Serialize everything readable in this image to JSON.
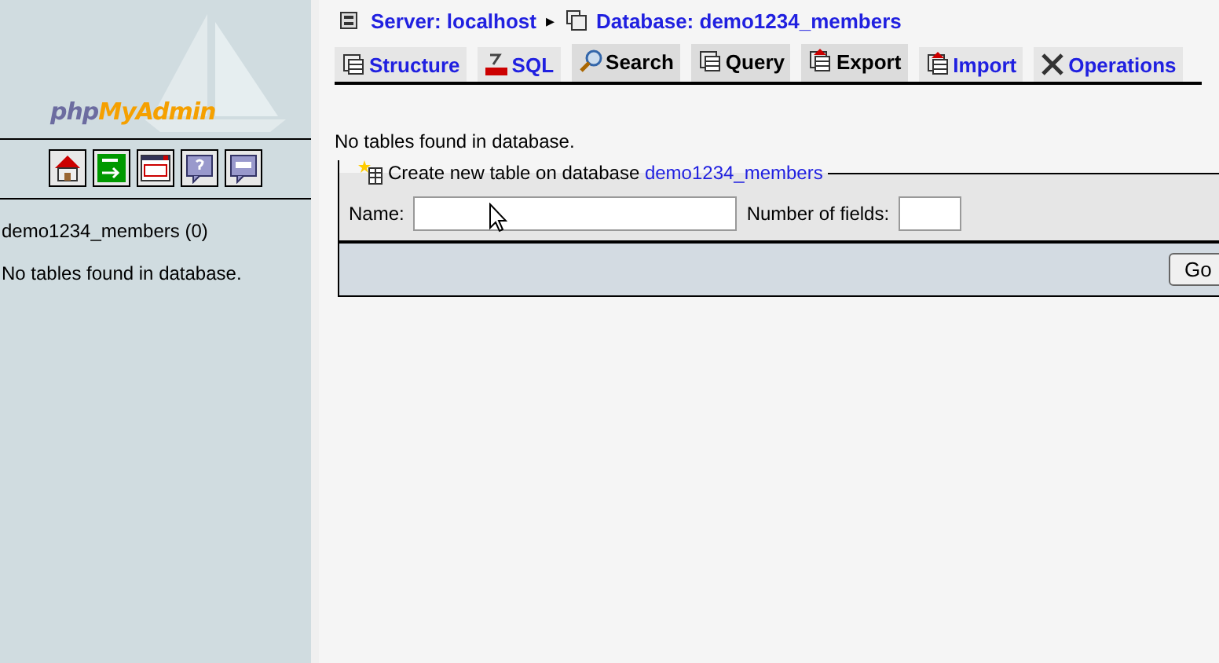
{
  "sidebar": {
    "logo": {
      "prefix": "php",
      "suffix": "MyAdmin"
    },
    "database": "demo1234_members (0)",
    "message": "No tables found in database."
  },
  "breadcrumb": {
    "server": "Server: localhost",
    "separator": "▸",
    "database": "Database: demo1234_members"
  },
  "tabs": [
    {
      "label": "Structure",
      "kind": "structure",
      "disabled": false
    },
    {
      "label": "SQL",
      "kind": "sql",
      "disabled": false
    },
    {
      "label": "Search",
      "kind": "search",
      "disabled": true
    },
    {
      "label": "Query",
      "kind": "query",
      "disabled": true
    },
    {
      "label": "Export",
      "kind": "export",
      "disabled": true
    },
    {
      "label": "Import",
      "kind": "import",
      "disabled": false
    },
    {
      "label": "Operations",
      "kind": "operations",
      "disabled": false
    }
  ],
  "message": "No tables found in database.",
  "create_table": {
    "legend": "Create new table on database",
    "database": "demo1234_members",
    "name_label": "Name:",
    "fields_label": "Number of fields:",
    "button": "Go"
  }
}
